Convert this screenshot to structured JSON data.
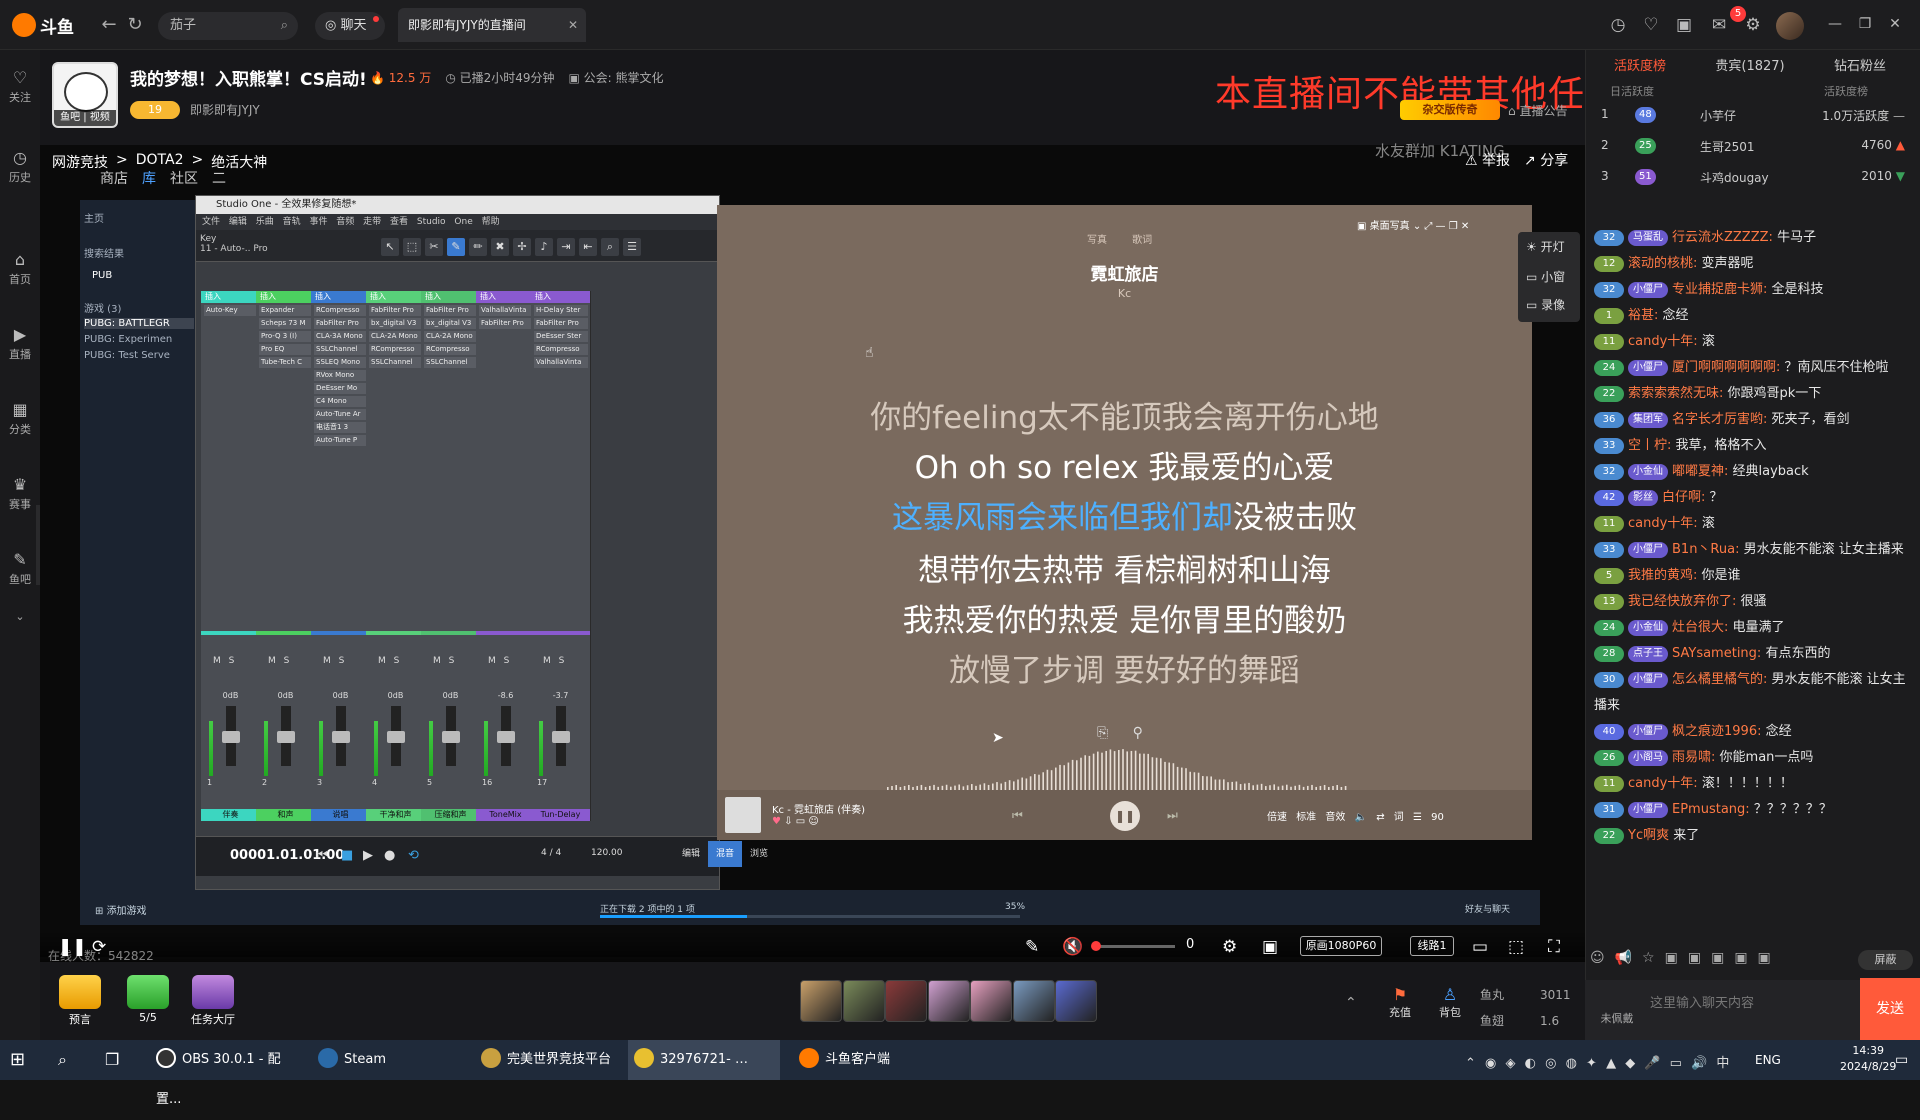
{
  "app": {
    "logo": "斗鱼",
    "search": "茄子",
    "chat_pill": "聊天",
    "tab_title": "即影即有JYJY的直播间"
  },
  "nav": [
    "关注",
    "历史",
    "首页",
    "直播",
    "分类",
    "赛事",
    "鱼吧"
  ],
  "topbar": {
    "badge": "5"
  },
  "streamer": {
    "avatar_label": "鱼吧 | 视频",
    "title": "我的梦想！入职熊掌！CS启动!",
    "hot": "12.5 万",
    "duration": "已播2小时49分钟",
    "guild": "公会: 熊掌文化",
    "level": "19",
    "name": "即影即有JYJY",
    "banner": "本直播间不能带其他任何主播节奏",
    "live_tag": "杂交版传奇",
    "announce": "直播公告"
  },
  "video": {
    "crumbs": [
      "网游竞技",
      ">",
      "DOTA2",
      ">",
      "绝活大神"
    ],
    "subnav": [
      "商店",
      "库",
      "社区",
      "二"
    ],
    "report": "举报",
    "share": "分享",
    "watermark": "水友群加 K1ATING",
    "steam_side": [
      "主页",
      "搜索结果",
      "PUB",
      "游戏 (3)",
      "PUBG: BATTLEGR",
      "PUBG: Experimen",
      "PUBG: Test Serve"
    ],
    "float_menu": [
      "开灯",
      "小窗",
      "录像"
    ]
  },
  "daw": {
    "title": "Studio One - 全效果修复随想*",
    "menu": "文件 编辑 乐曲 音轨 事件 音频 走带 查看 Studio One 帮助",
    "key": "Key",
    "key_sub": "11 - Auto-.. Pro",
    "channels": [
      {
        "num": "1",
        "name": "伴奏",
        "db": "0dB",
        "color": "#3cd6c0",
        "slots": [
          "Auto-Key"
        ]
      },
      {
        "num": "2",
        "name": "和声",
        "db": "0dB",
        "color": "#4cd060",
        "slots": [
          "Expander",
          "Scheps 73 M",
          "Pro-Q 3 (I)",
          "Pro EQ",
          "Tube-Tech C"
        ]
      },
      {
        "num": "3",
        "name": "说唱",
        "db": "0dB",
        "color": "#3a7ad0",
        "slots": [
          "RCompresso",
          "FabFilter Pro",
          "CLA-3A Mono",
          "SSLChannel",
          "SSLEQ Mono",
          "RVox Mono",
          "DeEsser Mo",
          "C4 Mono",
          "Auto-Tune Ar",
          "电话音1 3",
          "Auto-Tune P"
        ]
      },
      {
        "num": "4",
        "name": "干净和声",
        "db": "0dB",
        "color": "#58d07a",
        "slots": [
          "FabFilter Pro",
          "bx_digital V3",
          "CLA-2A Mono",
          "RCompresso",
          "SSLChannel"
        ]
      },
      {
        "num": "5",
        "name": "压缩和声",
        "db": "0dB",
        "color": "#50c070",
        "slots": [
          "FabFilter Pro",
          "bx_digital V3",
          "CLA-2A Mono",
          "RCompresso",
          "SSLChannel"
        ]
      },
      {
        "num": "16",
        "name": "ToneMix",
        "db": "-8.6",
        "color": "#8a5ad0",
        "slots": [
          "ValhallaVinta",
          "FabFilter Pro"
        ]
      },
      {
        "num": "17",
        "name": "Tun-Delay",
        "db": "-3.7",
        "color": "#8a5ad0",
        "slots": [
          "H-Delay Ster",
          "FabFilter Pro",
          "DeEsser Ster",
          "RCompresso",
          "ValhallaVinta"
        ]
      }
    ],
    "time": "00001.01.01.00",
    "time_sub": "小节",
    "sig": "4 / 4",
    "tempo": "120.00",
    "tabs": [
      "编辑",
      "混音",
      "浏览"
    ]
  },
  "lyrics": {
    "tabs": "写真 歌词",
    "desk": "桌面写真",
    "song": "霓虹旅店",
    "artist": "Kc",
    "lines": [
      "你的feeling太不能顶我会离开伤心地",
      "Oh oh so relex 我最爱的心爱",
      "这暴风雨会来临但我们却",
      "没被击败",
      "想带你去热带 看棕榈树和山海",
      "我热爱你的热爱 是你胃里的酸奶",
      "放慢了步调 要好好的舞蹈"
    ],
    "track": "Kc - 霓虹旅店 (伴奏)",
    "controls": [
      "倍速",
      "标准",
      "音效",
      "词",
      "90"
    ]
  },
  "download": {
    "add_game": "添加游戏",
    "status": "正在下载 2 项中的 1 项",
    "percent": "35%",
    "progress": 0.35,
    "friends": "好友与聊天"
  },
  "player": {
    "volume": "0",
    "online": "在线人数：542822",
    "quality": "原画1080P60",
    "line": "线路1"
  },
  "gifts": {
    "yugao": "预言",
    "tasks": "5/5",
    "hall": "任务大厅",
    "recharge": "充值",
    "bag": "背包",
    "fishball_label": "鱼丸",
    "fishball": "3011",
    "fishball2_label": "鱼翅",
    "fishball2": "1.6"
  },
  "right": {
    "tabs": [
      "活跃度榜",
      "贵宾(1827)",
      "钻石粉丝"
    ],
    "sub": "日活跃度",
    "sub2": "活跃度榜",
    "ranks": [
      {
        "n": "1",
        "lv": "48",
        "name": "小芋仔",
        "val": "1.0万活跃度"
      },
      {
        "n": "2",
        "lv": "25",
        "name": "生哥2501",
        "val": "4760"
      },
      {
        "n": "3",
        "lv": "51",
        "name": "斗鸡dougay",
        "val": "2010"
      }
    ],
    "chat": [
      {
        "lv": "32",
        "fan": "马蛋乱",
        "user": "行云流水ZZZZZ:",
        "text": "牛马子"
      },
      {
        "lv": "12",
        "fan": "",
        "user": "滚动的核桃:",
        "text": "变声器呢"
      },
      {
        "lv": "32",
        "fan": "小僵尸",
        "user": "专业捕捉鹿卡狮:",
        "text": "全是科技"
      },
      {
        "lv": "1",
        "fan": "",
        "user": "裕甚:",
        "text": "念经"
      },
      {
        "lv": "11",
        "fan": "",
        "user": "candy十年:",
        "text": "滚"
      },
      {
        "lv": "24",
        "fan": "小僵尸",
        "user": "厦门啊啊啊啊啊啊:",
        "text": "？南风压不住枪啦"
      },
      {
        "lv": "22",
        "fan": "",
        "user": "索索索索然无味:",
        "text": "你跟鸡哥pk一下"
      },
      {
        "lv": "36",
        "fan": "集团军",
        "user": "名字长才厉害哟:",
        "text": "死夹子，看剑"
      },
      {
        "lv": "33",
        "fan": "",
        "user": "空丨柠:",
        "text": "我草，格格不入"
      },
      {
        "lv": "32",
        "fan": "小金仙",
        "user": "嘟嘟夏神:",
        "text": "经典layback"
      },
      {
        "lv": "42",
        "fan": "影丝",
        "user": "白仔啊:",
        "text": "？"
      },
      {
        "lv": "11",
        "fan": "",
        "user": "candy十年:",
        "text": "滚"
      },
      {
        "lv": "33",
        "fan": "小僵尸",
        "user": "B1n丶Rua:",
        "text": "男水友能不能滚 让女主播来"
      },
      {
        "lv": "5",
        "fan": "",
        "user": "我推的黄鸡:",
        "text": "你是谁"
      },
      {
        "lv": "13",
        "fan": "",
        "user": "我已经快放弃你了:",
        "text": "很骚"
      },
      {
        "lv": "24",
        "fan": "小金仙",
        "user": "灶台很大:",
        "text": "电量满了"
      },
      {
        "lv": "28",
        "fan": "点子王",
        "user": "SAYsameting:",
        "text": "有点东西的"
      },
      {
        "lv": "30",
        "fan": "小僵尸",
        "user": "怎么橘里橘气的:",
        "text": "男水友能不能滚 让女主播来"
      },
      {
        "lv": "40",
        "fan": "小僵尸",
        "user": "枫之痕迹1996:",
        "text": "念经"
      },
      {
        "lv": "26",
        "fan": "小阁马",
        "user": "雨易啸:",
        "text": "你能man一点吗"
      },
      {
        "lv": "11",
        "fan": "",
        "user": "candy十年:",
        "text": "滚！！！！！！"
      },
      {
        "lv": "31",
        "fan": "小僵尸",
        "user": "EPmustang:",
        "text": "？？？？？？"
      },
      {
        "lv": "22",
        "fan": "",
        "user": "Yc啊爽",
        "text": "来了"
      }
    ],
    "screen": "屏蔽",
    "unlevel": "未佩戴",
    "placeholder": "这里输入聊天内容",
    "send": "发送"
  },
  "taskbar": {
    "items": [
      "OBS 30.0.1 - 配置...",
      "Steam",
      "完美世界竞技平台",
      "32976721-",
      "斗鱼客户端"
    ],
    "lang": "ENG",
    "time": "14:39",
    "date": "2024/8/29"
  }
}
